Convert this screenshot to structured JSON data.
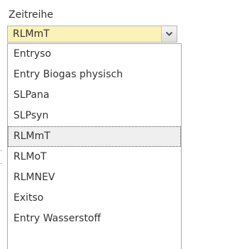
{
  "field": {
    "label": "Zeitreihe",
    "selected_value": "RLMmT",
    "arrow_icon": "chevron-down-icon"
  },
  "options": [
    "Entryso",
    "Entry Biogas physisch",
    "SLPana",
    "SLPsyn",
    "RLMmT",
    "RLMoT",
    "RLMNEV",
    "Exitso",
    "Entry Wasserstoff"
  ],
  "colors": {
    "select_background": "#fbf2b8",
    "selected_option_background": "#efefef",
    "text": "#333333"
  }
}
